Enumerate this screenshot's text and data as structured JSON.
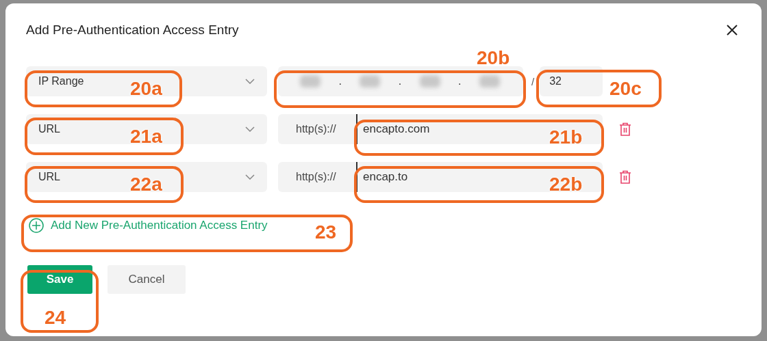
{
  "dialog": {
    "title": "Add Pre-Authentication Access Entry"
  },
  "entries": [
    {
      "kind": "ip_range",
      "type": "IP Range",
      "octets": [
        {
          "kind": "redacted"
        },
        {
          "kind": "redacted"
        },
        {
          "kind": "redacted"
        },
        {
          "kind": "redacted"
        }
      ],
      "separator": ".",
      "slash": "/",
      "prefix_length": "32"
    },
    {
      "kind": "url",
      "type": "URL",
      "scheme": "http(s)://",
      "value": "encapto.com"
    },
    {
      "kind": "url",
      "type": "URL",
      "scheme": "http(s)://",
      "value": "encap.to"
    }
  ],
  "add_link": "Add New Pre-Authentication Access Entry",
  "buttons": [
    {
      "kind": "primary",
      "label": "Save"
    },
    {
      "kind": "secondary",
      "label": "Cancel"
    }
  ],
  "callouts": [
    {
      "label": "20a"
    },
    {
      "label": "20b"
    },
    {
      "label": "20c"
    },
    {
      "label": "21a"
    },
    {
      "label": "21b"
    },
    {
      "label": "22a"
    },
    {
      "label": "22b"
    },
    {
      "label": "23"
    },
    {
      "label": "24"
    }
  ]
}
